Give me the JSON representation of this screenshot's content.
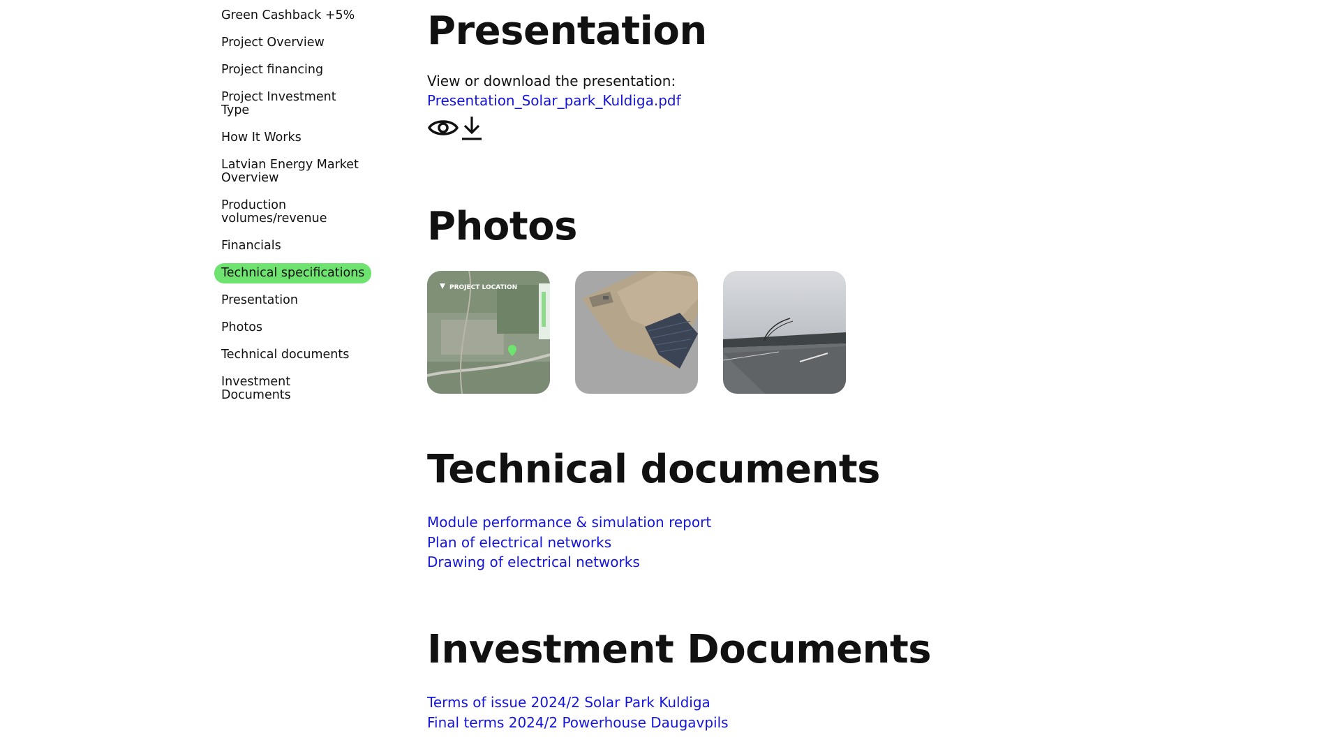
{
  "sidebar": {
    "items": [
      {
        "label": "Green Cashback +5%"
      },
      {
        "label": "Project Overview"
      },
      {
        "label": "Project financing"
      },
      {
        "label": "Project Investment Type"
      },
      {
        "label": "How It Works"
      },
      {
        "label": "Latvian Energy Market Overview"
      },
      {
        "label": "Production volumes/revenue"
      },
      {
        "label": "Financials"
      },
      {
        "label": "Technical specifications"
      },
      {
        "label": "Presentation"
      },
      {
        "label": "Photos"
      },
      {
        "label": "Technical documents"
      },
      {
        "label": "Investment Documents"
      }
    ],
    "active_color": "#6fe36f"
  },
  "presentation": {
    "title": "Presentation",
    "intro": "View or download the presentation:",
    "file_link": "Presentation_Solar_park_Kuldiga.pdf",
    "view_icon": "eye-icon",
    "download_icon": "download-icon"
  },
  "photos": {
    "title": "Photos",
    "items": [
      {
        "caption": "PROJECT LOCATION"
      },
      {
        "caption": ""
      },
      {
        "caption": ""
      }
    ]
  },
  "technical_documents": {
    "title": "Technical documents",
    "links": [
      "Module performance & simulation report",
      "Plan of electrical networks",
      "Drawing of electrical networks"
    ]
  },
  "investment_documents": {
    "title": "Investment Documents",
    "links": [
      "Terms of issue 2024/2 Solar Park Kuldiga",
      "Final terms 2024/2 Powerhouse Daugavpils"
    ]
  },
  "colors": {
    "link": "#1515d9",
    "text": "#111111",
    "active_nav": "#6fe36f"
  }
}
